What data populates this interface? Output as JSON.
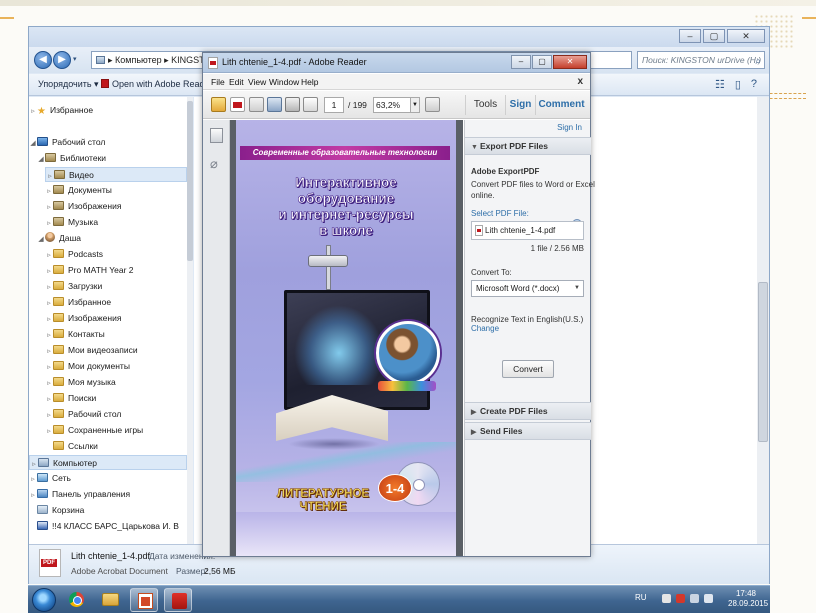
{
  "explorer": {
    "address_path": "▸ Компьютер ▸ KINGSTON urDrive (H:)",
    "search_placeholder": "Поиск: KINGSTON urDrive (H:)",
    "commands": {
      "organize": "Упорядочить ▾",
      "open_with": "Open with Adobe Reader X ▾"
    },
    "nav": [
      {
        "label": "Избранное",
        "icon": "star-icon"
      },
      {
        "label": "Рабочий стол",
        "icon": "desktop-icon"
      },
      {
        "label": "Библиотеки",
        "icon": "library-icon"
      },
      {
        "label": "Видео",
        "icon": "video-icon",
        "selected": true
      },
      {
        "label": "Документы",
        "icon": "documents-icon"
      },
      {
        "label": "Изображения",
        "icon": "pictures-icon"
      },
      {
        "label": "Музыка",
        "icon": "music-icon"
      },
      {
        "label": "Даша",
        "icon": "user-icon"
      },
      {
        "label": "Podcasts",
        "icon": "folder-icon"
      },
      {
        "label": "Pro MATH Year 2",
        "icon": "folder-icon"
      },
      {
        "label": "Загрузки",
        "icon": "downloads-icon"
      },
      {
        "label": "Избранное",
        "icon": "favorites-icon"
      },
      {
        "label": "Изображения",
        "icon": "pictures-icon"
      },
      {
        "label": "Контакты",
        "icon": "contacts-icon"
      },
      {
        "label": "Мои видеозаписи",
        "icon": "folder-icon"
      },
      {
        "label": "Мои документы",
        "icon": "folder-icon"
      },
      {
        "label": "Моя музыка",
        "icon": "folder-icon"
      },
      {
        "label": "Поиски",
        "icon": "search-folder-icon"
      },
      {
        "label": "Рабочий стол",
        "icon": "folder-icon"
      },
      {
        "label": "Сохраненные игры",
        "icon": "folder-icon"
      },
      {
        "label": "Ссылки",
        "icon": "links-icon"
      },
      {
        "label": "Компьютер",
        "icon": "computer-icon",
        "selected": true
      },
      {
        "label": "Сеть",
        "icon": "network-icon"
      },
      {
        "label": "Панель управления",
        "icon": "control-panel-icon"
      },
      {
        "label": "Корзина",
        "icon": "recycle-bin-icon"
      },
      {
        "label": "!!4 КЛАСС БАРС_Царькова И. В",
        "icon": "word-doc-icon"
      }
    ],
    "details": {
      "file_name": "Lith chtenie_1-4.pdf",
      "file_type": "Adobe Acrobat Document",
      "modified_label": "Дата изменения:",
      "size_label": "Размер:",
      "size_value": "2,56 МБ"
    }
  },
  "reader": {
    "title": "Lith chtenie_1-4.pdf - Adobe Reader",
    "menu": [
      "File",
      "Edit",
      "View",
      "Window",
      "Help"
    ],
    "menu_close": "x",
    "page_current": "1",
    "page_total": "/ 199",
    "zoom": "63,2%",
    "tabs": [
      "Tools",
      "Sign",
      "Comment"
    ],
    "panel": {
      "sign_in": "Sign In",
      "export_header": "Export PDF Files",
      "export_title": "Adobe ExportPDF",
      "export_desc_1": "Convert PDF files to Word or Excel",
      "export_desc_2": "online.",
      "select_label": "Select PDF File:",
      "file_name": "Lith chtenie_1-4.pdf",
      "file_count": "1 file / 2.56 MB",
      "convert_to_label": "Convert To:",
      "convert_to_value": "Microsoft Word (*.docx)",
      "recognize": "Recognize Text in English(U.S.)",
      "change": "Change",
      "convert_button": "Convert",
      "create_header": "Create PDF Files",
      "send_header": "Send Files"
    },
    "cover": {
      "banner": "Современные образовательные технологии",
      "title_1": "Интерактивное оборудование",
      "title_2": "и интернет-ресурсы",
      "title_3": "в школе",
      "subject_1": "ЛИТЕРАТУРНОЕ",
      "subject_2": "ЧТЕНИЕ",
      "grade": "1-4"
    }
  },
  "taskbar": {
    "lang": "RU",
    "time": "17:48",
    "date": "28.09.2015"
  },
  "colors": {
    "explorer_chrome": "#dfe9f5",
    "reader_link": "#2d6ea8",
    "cover_violet": "#9fa0dd",
    "taskbar": "#3f6590"
  }
}
